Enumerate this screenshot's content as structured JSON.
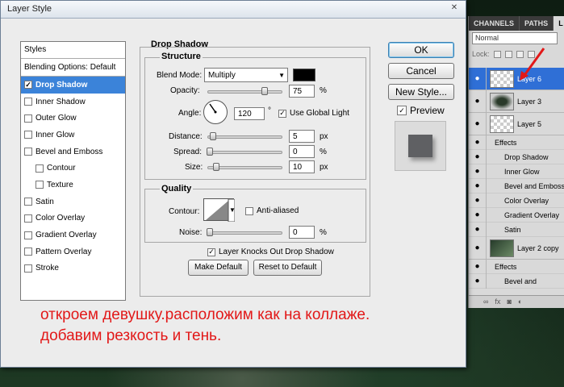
{
  "layers_panel": {
    "tabs": [
      "CHANNELS",
      "PATHS",
      "L"
    ],
    "blend_mode": "Normal",
    "lock_label": "Lock:",
    "layers": [
      {
        "name": "Layer 6",
        "selected": true
      },
      {
        "name": "Layer 3"
      },
      {
        "name": "Layer 5"
      }
    ],
    "effects_label": "Effects",
    "effects": [
      "Drop Shadow",
      "Inner Glow",
      "Bevel and Emboss",
      "Color Overlay",
      "Gradient Overlay",
      "Satin"
    ],
    "layer_2_copy": "Layer 2 copy",
    "effects_label_2": "Effects",
    "effect_cut": "Bevel and",
    "footer_fx": "fx"
  },
  "dialog": {
    "title": "Layer Style",
    "close": "✕",
    "styles_header": "Styles",
    "blending_options": "Blending Options: Default",
    "style_items": [
      {
        "label": "Drop Shadow",
        "checked": true,
        "selected": true
      },
      {
        "label": "Inner Shadow"
      },
      {
        "label": "Outer Glow"
      },
      {
        "label": "Inner Glow"
      },
      {
        "label": "Bevel and Emboss"
      },
      {
        "label": "Contour",
        "sub": true
      },
      {
        "label": "Texture",
        "sub": true
      },
      {
        "label": "Satin"
      },
      {
        "label": "Color Overlay"
      },
      {
        "label": "Gradient Overlay"
      },
      {
        "label": "Pattern Overlay"
      },
      {
        "label": "Stroke"
      }
    ],
    "drop_shadow": {
      "title": "Drop Shadow",
      "structure": "Structure",
      "blend_mode_label": "Blend Mode:",
      "blend_mode": "Multiply",
      "shadow_color": "#000000",
      "opacity_label": "Opacity:",
      "opacity": "75",
      "opacity_unit": "%",
      "opacity_level": 0.75,
      "angle_label": "Angle:",
      "angle": "120",
      "angle_unit": "°",
      "use_global_light": "Use Global Light",
      "distance_label": "Distance:",
      "distance": "5",
      "distance_unit": "px",
      "spread_label": "Spread:",
      "spread": "0",
      "spread_unit": "%",
      "size_label": "Size:",
      "size": "10",
      "size_unit": "px",
      "quality": "Quality",
      "contour_label": "Contour:",
      "anti_aliased": "Anti-aliased",
      "noise_label": "Noise:",
      "noise": "0",
      "noise_unit": "%",
      "knocks_out": "Layer Knocks Out Drop Shadow",
      "make_default": "Make Default",
      "reset_default": "Reset to Default"
    },
    "buttons": {
      "ok": "OK",
      "cancel": "Cancel",
      "new_style": "New Style...",
      "preview": "Preview"
    }
  },
  "caption": {
    "line1": "откроем девушку.расположим как на коллаже.",
    "line2": "добавим резкость и тень."
  }
}
